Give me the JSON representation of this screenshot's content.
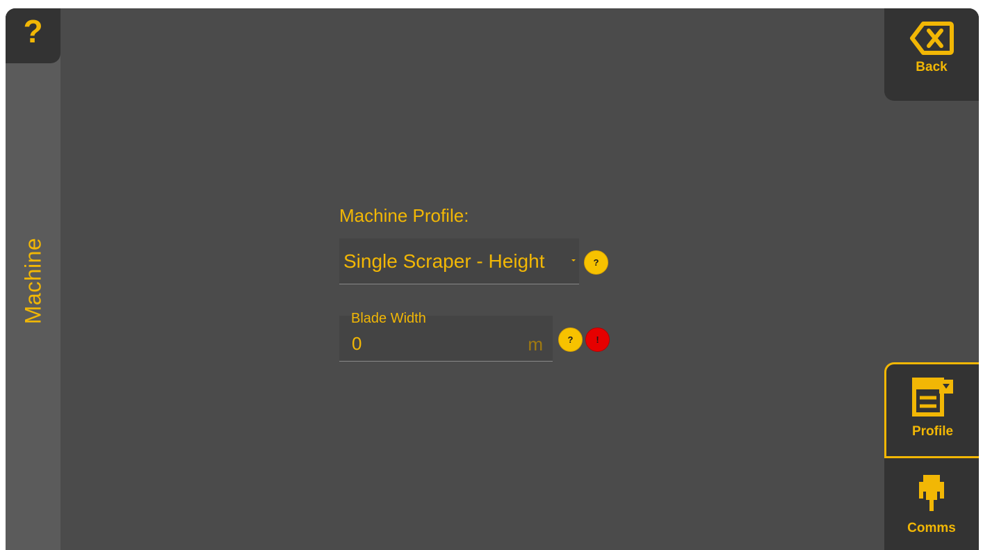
{
  "left_rail": {
    "help_icon": "question-mark-icon",
    "help_glyph": "?",
    "title": "Machine"
  },
  "nav": {
    "back": {
      "label": "Back",
      "icon": "backspace-x-icon"
    },
    "tabs": [
      {
        "label": "Profile",
        "icon": "profile-form-icon",
        "selected": true
      },
      {
        "label": "Comms",
        "icon": "connector-plug-icon",
        "selected": false
      }
    ]
  },
  "form": {
    "profile_caption": "Machine Profile:",
    "profile_value": "Single Scraper - Height",
    "profile_help_glyph": "?",
    "blade_width": {
      "label": "Blade Width",
      "value": "0",
      "unit": "m",
      "help_glyph": "?",
      "error_glyph": "!"
    }
  },
  "colors": {
    "accent": "#f2b705",
    "background": "#4b4b4b",
    "panel": "#333333",
    "error": "#e60000"
  }
}
